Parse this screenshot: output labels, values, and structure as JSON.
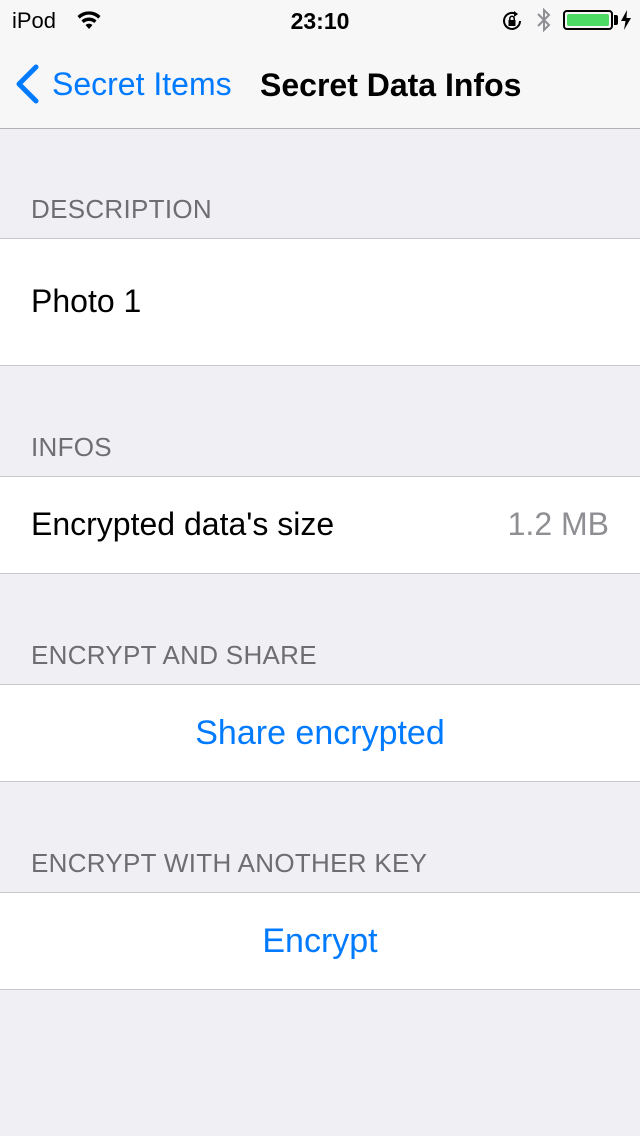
{
  "status_bar": {
    "carrier": "iPod",
    "time": "23:10",
    "battery_level": 1.0,
    "colors": {
      "battery": "#4cd964"
    }
  },
  "nav": {
    "back_label": "Secret Items",
    "title": "Secret Data Infos",
    "back_icon": "chevron-left-icon"
  },
  "sections": {
    "description": {
      "header": "DESCRIPTION",
      "value": "Photo 1"
    },
    "infos": {
      "header": "INFOS",
      "label": "Encrypted data's size",
      "value": "1.2 MB"
    },
    "share": {
      "header": "ENCRYPT AND SHARE",
      "action": "Share encrypted"
    },
    "reencrypt": {
      "header": "ENCRYPT WITH ANOTHER KEY",
      "action": "Encrypt"
    }
  },
  "colors": {
    "tint": "#007aff",
    "background": "#efeff4",
    "header_text": "#6d6d72",
    "secondary_text": "#8e8e93"
  }
}
